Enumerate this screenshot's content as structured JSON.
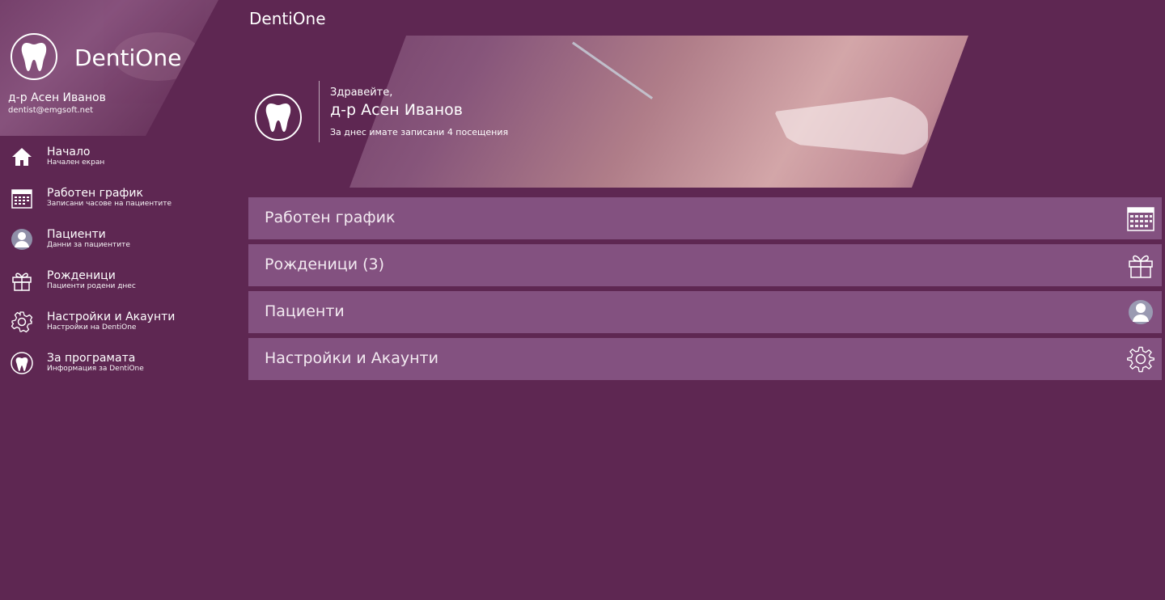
{
  "app": {
    "title": "DentiOne"
  },
  "sidebar": {
    "brand": "DentiOne",
    "user_name": "д-р Асен Иванов",
    "user_email": "dentist@emgsoft.net",
    "items": [
      {
        "label": "Начало",
        "sub": "Начален екран",
        "icon": "home-icon"
      },
      {
        "label": "Работен график",
        "sub": "Записани часове на пациентите",
        "icon": "calendar-icon"
      },
      {
        "label": "Пациенти",
        "sub": "Данни за пациентите",
        "icon": "patient-icon"
      },
      {
        "label": "Рожденици",
        "sub": "Пациенти родени днес",
        "icon": "gift-icon"
      },
      {
        "label": "Настройки и Акаунти",
        "sub": "Настройки на DentiOne",
        "icon": "gear-icon"
      },
      {
        "label": "За програмата",
        "sub": "Информация за DentiOne",
        "icon": "tooth-icon"
      }
    ]
  },
  "hero": {
    "greeting": "Здравейте,",
    "name": "д-р Асен Иванов",
    "visits": "За днес имате записани 4 посещения"
  },
  "tiles": [
    {
      "label": "Работен график",
      "icon": "calendar-icon"
    },
    {
      "label": "Рожденици (3)",
      "icon": "gift-icon"
    },
    {
      "label": "Пациенти",
      "icon": "patient-icon"
    },
    {
      "label": "Настройки и Акаунти",
      "icon": "gear-icon"
    }
  ],
  "colors": {
    "background": "#5e2752",
    "tile": "#835180",
    "text": "#ffffff"
  }
}
